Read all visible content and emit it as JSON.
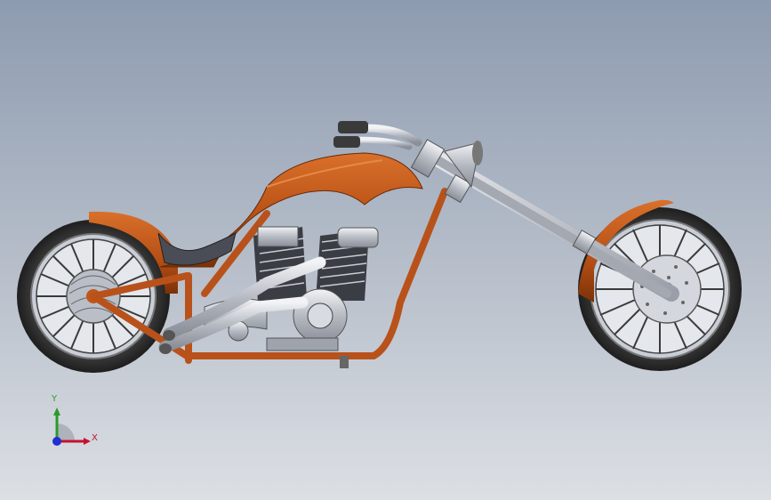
{
  "viewport": {
    "background_top": "#8d9bb0",
    "background_bottom": "#dcdfe4"
  },
  "model": {
    "frame_color": "#c0561a",
    "chrome_color": "#c9ccd3",
    "tire_color": "#2b2b2b"
  },
  "triad": {
    "x_label": "X",
    "y_label": "Y",
    "x_color": "#c8102e",
    "y_color": "#2a9a2a",
    "z_color": "#1f2fd0"
  }
}
